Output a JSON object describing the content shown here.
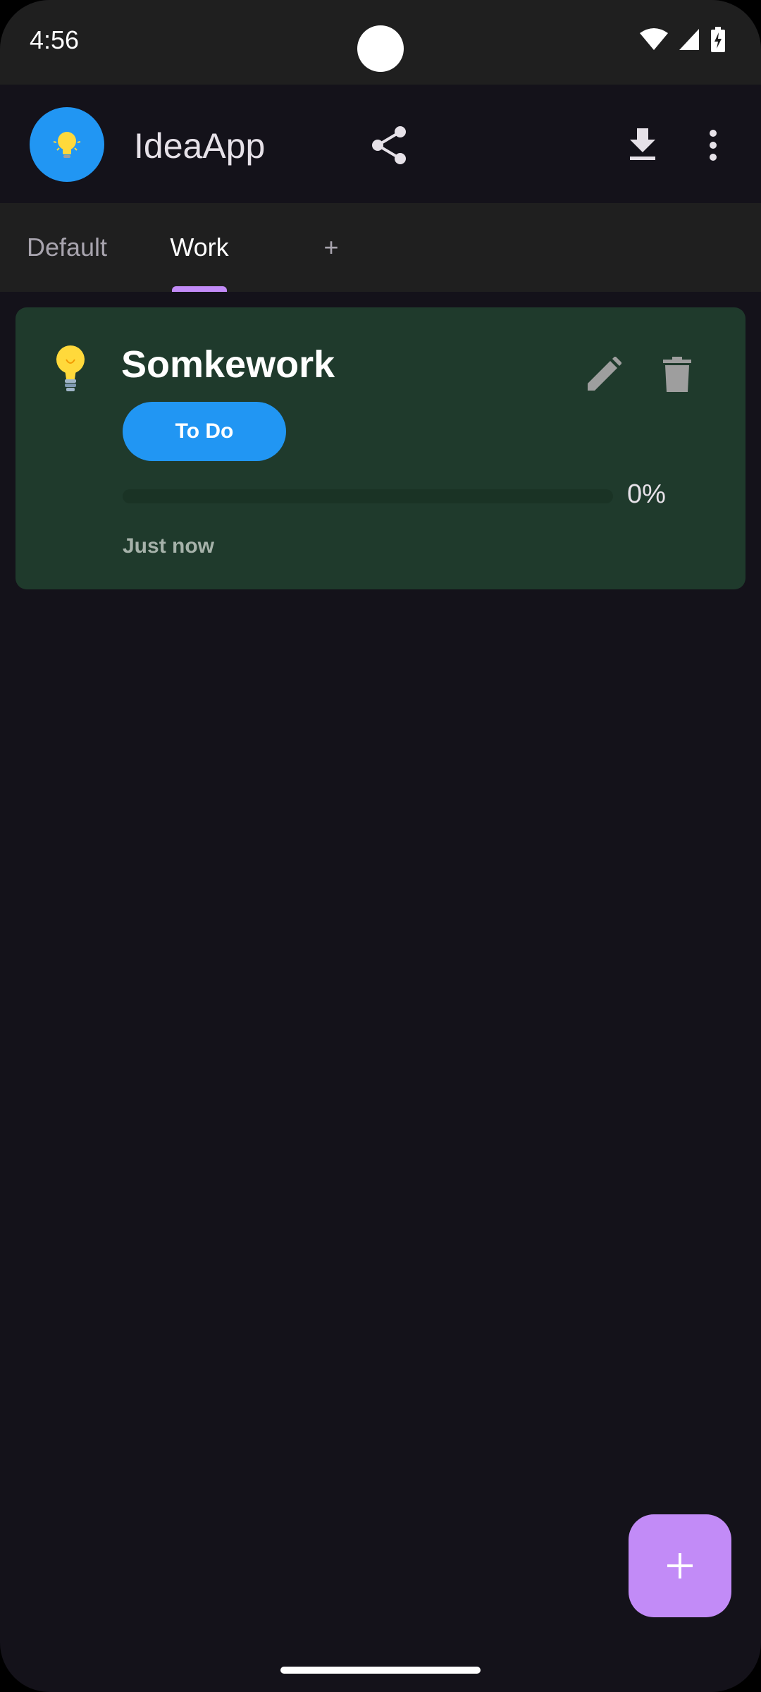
{
  "status_bar": {
    "time": "4:56",
    "icons": [
      "wifi-icon",
      "signal-icon",
      "battery-icon"
    ]
  },
  "app_bar": {
    "title": "IdeaApp",
    "logo_icon": "lightbulb-icon",
    "actions": [
      "share-icon",
      "download-icon",
      "more-vert-icon"
    ]
  },
  "tabs": [
    {
      "label": "Default",
      "active": false
    },
    {
      "label": "Work",
      "active": true
    },
    {
      "label": "+",
      "active": false
    }
  ],
  "card": {
    "icon": "lightbulb-icon",
    "title": "Somkework",
    "status": "To Do",
    "progress_label": "0%",
    "progress_value": 0,
    "time": "Just now"
  },
  "colors": {
    "background": "#14121a",
    "bar": "#1f1f1f",
    "accent": "#c28bf7",
    "primary": "#2196f3",
    "card": "#1f3a2c"
  },
  "fab": {
    "icon": "plus-icon"
  }
}
